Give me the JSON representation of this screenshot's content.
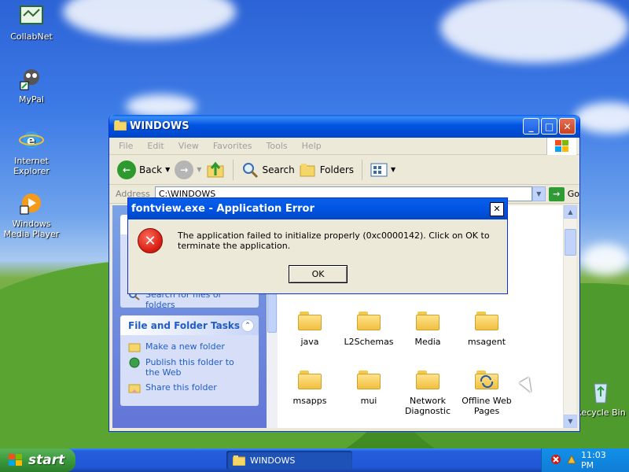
{
  "desktop": {
    "icons": [
      {
        "label": "CollabNet",
        "icon": "collabnet-icon"
      },
      {
        "label": "MyPal",
        "icon": "mypal-icon"
      },
      {
        "label": "Internet Explorer",
        "icon": "internet-explorer-icon"
      },
      {
        "label": "Windows Media Player",
        "icon": "media-player-icon"
      },
      {
        "label": "Recycle Bin",
        "icon": "recycle-bin-icon"
      }
    ]
  },
  "explorer": {
    "title": "WINDOWS",
    "menu": [
      "File",
      "Edit",
      "View",
      "Favorites",
      "Tools",
      "Help"
    ],
    "toolbar": {
      "back": "Back",
      "search": "Search",
      "folders": "Folders"
    },
    "address": {
      "label": "Address",
      "value": "C:\\WINDOWS",
      "go": "Go"
    },
    "left_pane": {
      "partial_task": "Search for files or folders",
      "file_tasks_title": "File and Folder Tasks",
      "tasks": [
        "Make a new folder",
        "Publish this folder to the Web",
        "Share this folder"
      ]
    },
    "files": [
      "java",
      "L2Schemas",
      "Media",
      "msagent",
      "msapps",
      "mui",
      "Network Diagnostic",
      "Offline Web Pages"
    ]
  },
  "dialog": {
    "title": "fontview.exe - Application Error",
    "message": "The application failed to initialize properly (0xc0000142). Click on OK to terminate the application.",
    "ok": "OK"
  },
  "taskbar": {
    "start": "start",
    "window_button": "WINDOWS",
    "clock": "11:03 PM"
  },
  "colors": {
    "title_blue": "#0054e3",
    "start_green": "#3c9a3c",
    "error_red": "#d31a0e"
  }
}
